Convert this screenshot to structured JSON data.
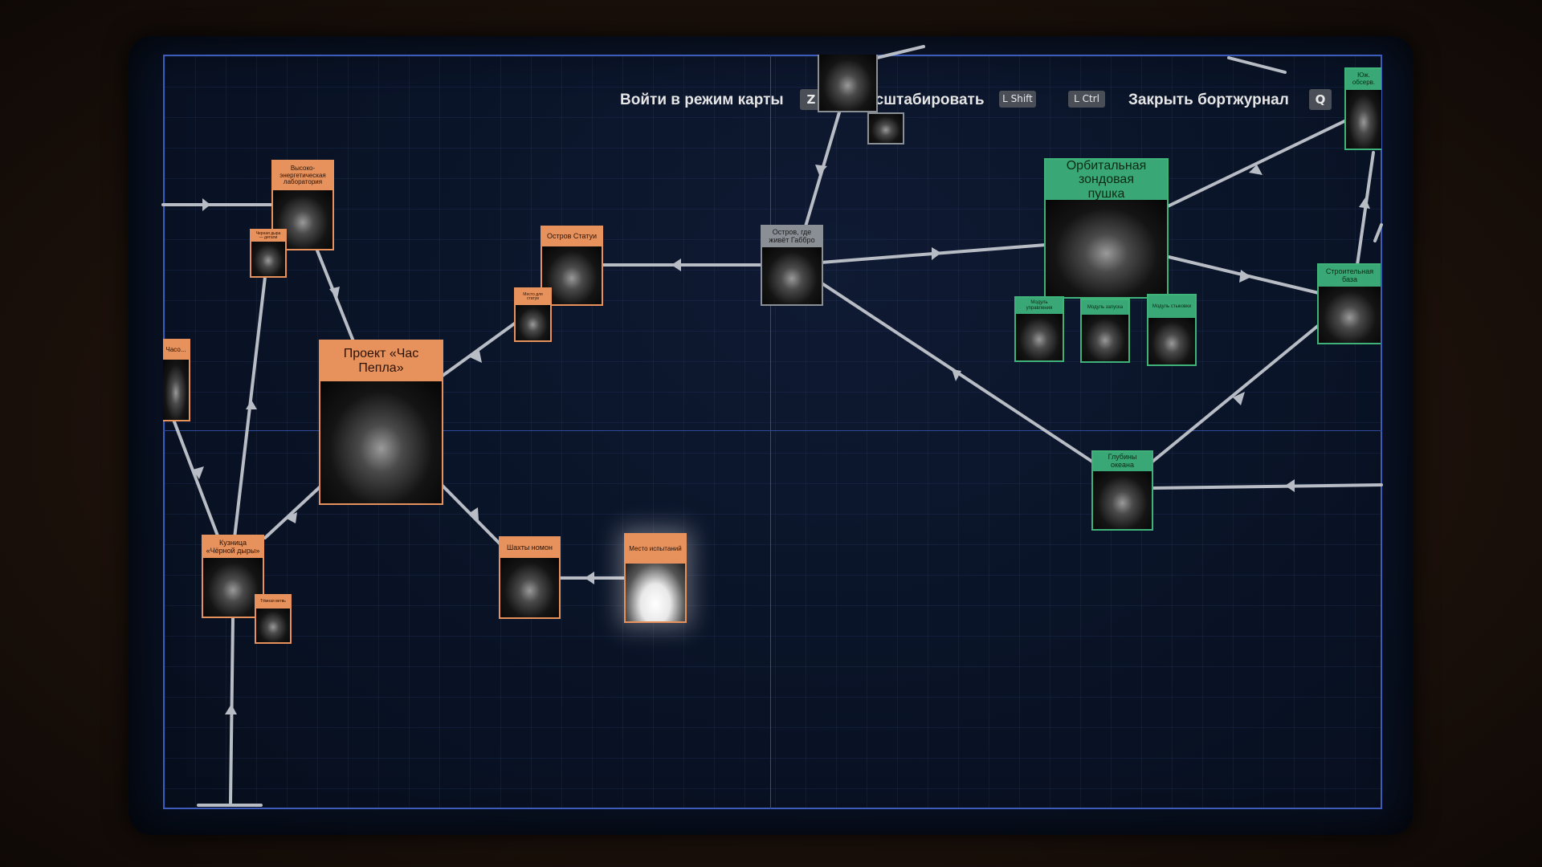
{
  "hints": {
    "map_mode": "Войти в режим карты",
    "map_key": "Z",
    "zoom": "Масштабировать",
    "zoom_key1": "L Shift",
    "zoom_key2": "L Ctrl",
    "close": "Закрыть бортжурнал",
    "close_key": "Q"
  },
  "cards": {
    "lab": "Высоко-энергетическая лаборатория",
    "lab_small": "Черная дыра — детали",
    "statue_island": "Остров Статуи",
    "statue_small": "Место для статуи",
    "ash_project": "Проект «Час Пепла»",
    "left_edge": "Часо...",
    "forge": "Кузница «Чёрной дыры»",
    "forge_small": "Тёмная ветвь",
    "mines": "Шахты номон",
    "test_site": "Место испытаний",
    "gabbro_island": "Остров, где живёт Габбро",
    "orbital_cannon": "Орбитальная зондовая пушка",
    "cannon_a": "Модуль управления",
    "cannon_b": "Модуль запуска",
    "cannon_c": "Модуль стыковки",
    "construction_yard": "Строительная база",
    "top_right": "Юж. обсерв.",
    "deep_ocean": "Глубины океана"
  },
  "colors": {
    "orange": "#e7925c",
    "green": "#3aa876",
    "gray": "#8a8f96",
    "link": "#b8bcc4"
  }
}
